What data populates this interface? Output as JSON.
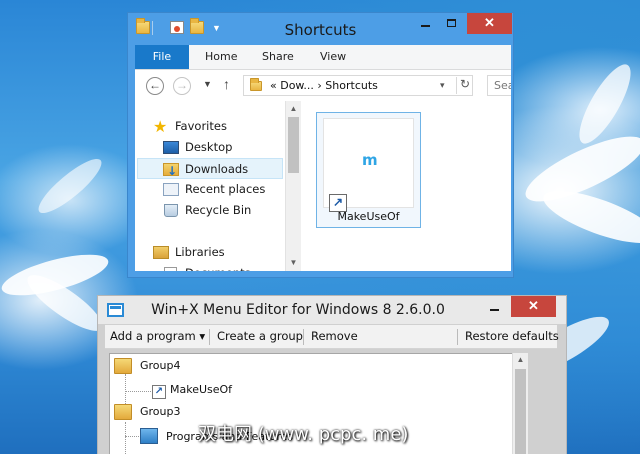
{
  "explorer": {
    "title": "Shortcuts",
    "ribbon_tabs": [
      "File",
      "Home",
      "Share",
      "View"
    ],
    "address_text": "«  Dow...  ›  Shortcuts",
    "search_placeholder": "Sea",
    "nav_items": [
      "Favorites",
      "Desktop",
      "Downloads",
      "Recent places",
      "Recycle Bin",
      "Libraries",
      "Documents"
    ],
    "selected_nav_item": "Downloads",
    "file": {
      "name": "MakeUseOf",
      "thumb_letter": "m"
    }
  },
  "editor": {
    "title": "Win+X Menu Editor for Windows 8 2.6.0.0",
    "toolbar": {
      "add_program": "Add a program",
      "add_program_dropdown": "▾",
      "create_group": "Create a group",
      "remove": "Remove",
      "restore_defaults": "Restore defaults"
    },
    "tree": {
      "group4": "Group4",
      "group4_item": "MakeUseOf",
      "group3": "Group3",
      "group3_item": "Programs and Features"
    }
  },
  "watermark": "双电网 (www. pcpc. me)",
  "colors": {
    "close_button": "#c7463d",
    "file_tab": "#1979ca",
    "window_frame": "#4d9ee6",
    "selection": "#e5f3fb"
  }
}
